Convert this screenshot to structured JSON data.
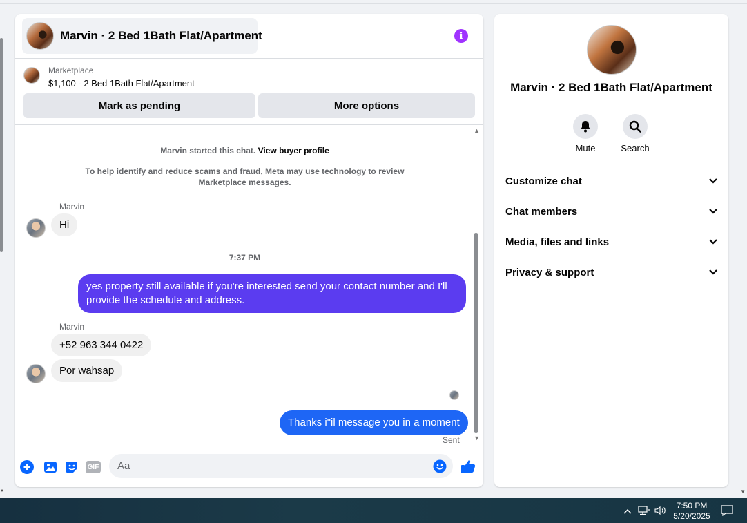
{
  "chat": {
    "header_title": "Marvin · 2 Bed 1Bath Flat/Apartment",
    "listing": {
      "source": "Marketplace",
      "price_title": "$1,100 - 2 Bed 1Bath Flat/Apartment",
      "mark_pending_label": "Mark as pending",
      "more_options_label": "More options"
    },
    "system": {
      "started_text": "Marvin started this chat.",
      "view_profile_link": "View buyer profile",
      "scam_notice": "To help identify and reduce scams and fraud, Meta may use technology to review Marketplace messages."
    },
    "messages": [
      {
        "sender": "Marvin",
        "text": "Hi"
      },
      {
        "timestamp": "7:37 PM"
      },
      {
        "sender": "me",
        "text": "yes property still available if you're interested send your contact number and I'll provide the schedule and address."
      },
      {
        "sender": "Marvin",
        "text": "+52 963 344 0422"
      },
      {
        "sender": "Marvin",
        "text": "Por wahsap"
      },
      {
        "sender": "me",
        "text": "Thanks i\"il message you in a moment",
        "status": "Sent"
      }
    ],
    "composer": {
      "placeholder": "Aa"
    }
  },
  "side": {
    "title": "Marvin · 2 Bed 1Bath Flat/Apartment",
    "actions": [
      {
        "label": "Mute",
        "icon": "bell-icon"
      },
      {
        "label": "Search",
        "icon": "search-icon"
      }
    ],
    "sections": [
      {
        "label": "Customize chat"
      },
      {
        "label": "Chat members"
      },
      {
        "label": "Media, files and links"
      },
      {
        "label": "Privacy & support"
      }
    ]
  },
  "taskbar": {
    "time": "7:50 PM",
    "date": "5/20/2025"
  },
  "colors": {
    "outgoing_purple": "#5b3cf0",
    "outgoing_blue": "#0866ff",
    "info_purple": "#a033ff"
  }
}
